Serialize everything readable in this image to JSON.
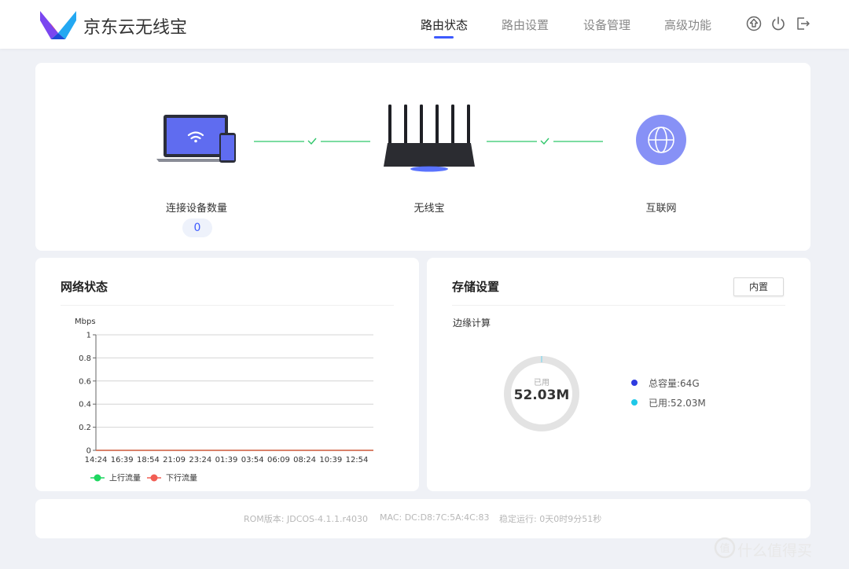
{
  "header": {
    "brand": "京东云无线宝",
    "nav": [
      "路由状态",
      "路由设置",
      "设备管理",
      "高级功能"
    ],
    "active_nav": "路由状态",
    "icons": [
      "upgrade-icon",
      "power-icon",
      "logout-icon"
    ]
  },
  "topology": {
    "devices_label": "连接设备数量",
    "devices_count": "0",
    "router_label": "无线宝",
    "internet_label": "互联网",
    "link_status": [
      "connected",
      "connected"
    ]
  },
  "network": {
    "title": "网络状态",
    "unit": "Mbps",
    "legend": [
      "上行流量",
      "下行流量"
    ],
    "colors": {
      "up": "#1ed760",
      "down": "#f25e54"
    }
  },
  "chart_data": {
    "type": "line",
    "ylabel": "Mbps",
    "ylim": [
      0,
      1
    ],
    "yticks": [
      "0",
      "0.2",
      "0.4",
      "0.6",
      "0.8",
      "1"
    ],
    "x": [
      "14:24",
      "16:39",
      "18:54",
      "21:09",
      "23:24",
      "01:39",
      "03:54",
      "06:09",
      "08:24",
      "10:39",
      "12:54"
    ],
    "series": [
      {
        "name": "上行流量",
        "values": [
          0,
          0,
          0,
          0,
          0,
          0,
          0,
          0,
          0,
          0,
          0
        ]
      },
      {
        "name": "下行流量",
        "values": [
          0,
          0,
          0,
          0,
          0,
          0,
          0,
          0,
          0,
          0,
          0
        ]
      }
    ],
    "grid": true,
    "legend_position": "bottom-left"
  },
  "storage": {
    "title": "存储设置",
    "builtin_button": "内置",
    "edge_label": "边缘计算",
    "used_label": "已用",
    "used_value": "52.03M",
    "total_legend": "总容量:64G",
    "used_legend": "已用:52.03M",
    "colors": {
      "total": "#2f3be0",
      "used": "#1ec8e8",
      "ring": "#e3e3e3"
    }
  },
  "footer": {
    "rom": "ROM版本: JDCOS-4.1.1.r4030",
    "mac": "MAC: DC:D8:7C:5A:4C:83",
    "uptime": "稳定运行: 0天0时9分51秒"
  },
  "watermark": {
    "logo_text": "值",
    "text": "什么值得买"
  }
}
